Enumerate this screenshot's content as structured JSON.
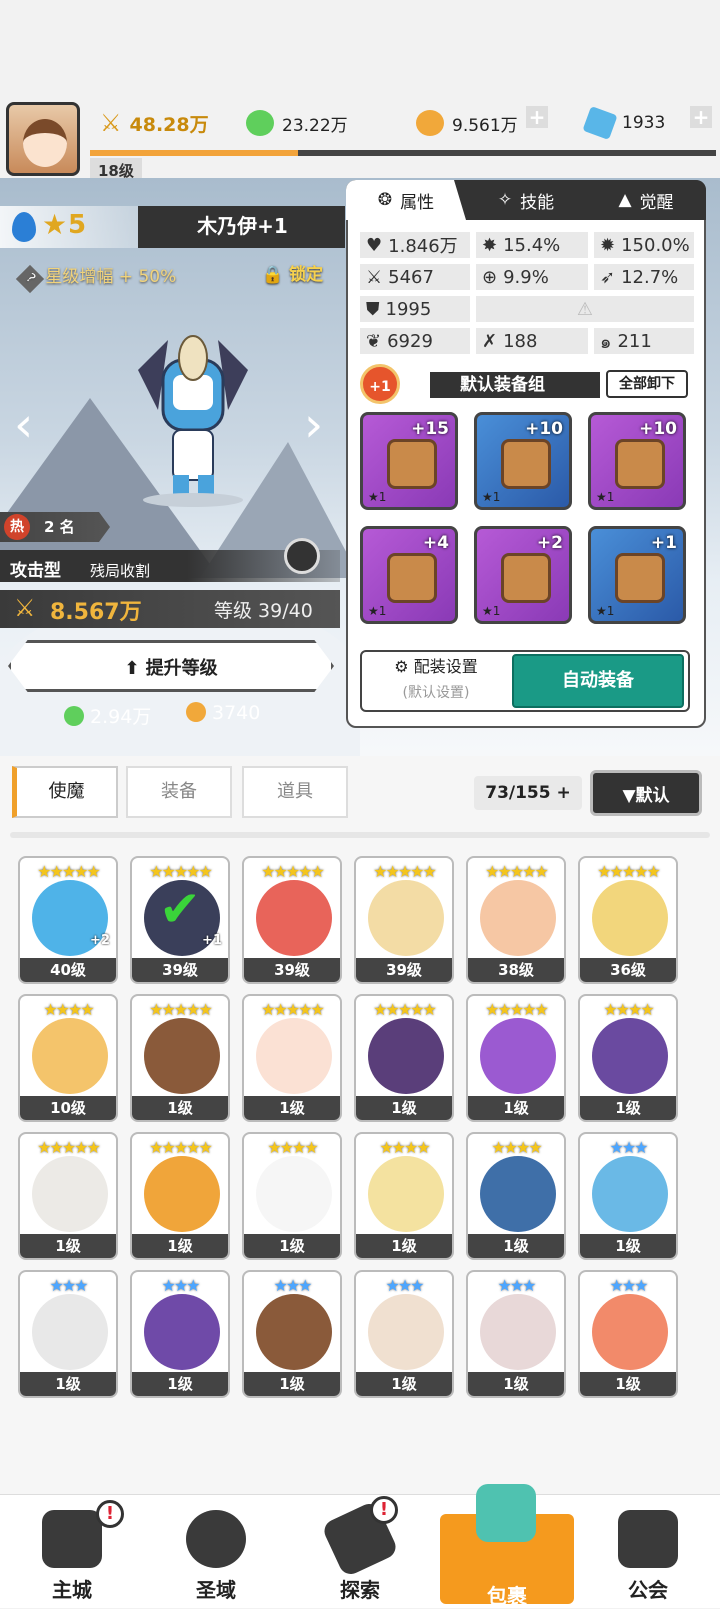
{
  "topbar": {
    "level": "18级",
    "power": "48.28万",
    "green": "23.22万",
    "gold": "9.561万",
    "gem": "1933"
  },
  "hero": {
    "stars": "5",
    "name": "木乃伊+1",
    "bonus": "星级增幅 + 50%",
    "lock": "锁定",
    "hot_tag": "热",
    "rank": "2 名",
    "type": "攻击型",
    "role": "残局收割",
    "power": "8.567万",
    "level": "等级 39/40",
    "upgrade": "提升等级",
    "cost_green": "2.94万",
    "cost_gold": "3740"
  },
  "panel": {
    "tabs": [
      "属性",
      "技能",
      "觉醒"
    ],
    "stats": {
      "hp": "1.846万",
      "crit": "15.4%",
      "critdmg": "150.0%",
      "atk": "5467",
      "acc": "9.9%",
      "speed": "12.7%",
      "def": "1995",
      "v1": "6929",
      "v2": "188",
      "v3": "211"
    },
    "equip_title": "默认装备组",
    "plus1": "+1",
    "unequip": "全部卸下",
    "equips": [
      {
        "lv": "+15",
        "st": "★1",
        "color": "purple"
      },
      {
        "lv": "+10",
        "st": "★1",
        "color": "blue"
      },
      {
        "lv": "+10",
        "st": "★1",
        "color": "purple"
      },
      {
        "lv": "+4",
        "st": "★1",
        "color": "purple"
      },
      {
        "lv": "+2",
        "st": "★1",
        "color": "purple"
      },
      {
        "lv": "+1",
        "st": "★1",
        "color": "blue"
      }
    ],
    "setting": "配装设置",
    "setting_sub": "(默认设置)",
    "auto": "自动装备"
  },
  "inventory": {
    "tabs": [
      "使魔",
      "装备",
      "道具"
    ],
    "count": "73/155",
    "count_plus": "+",
    "sort": "▼默认",
    "cards": [
      {
        "lv": "40级",
        "stars": "★★★★★",
        "plus": "+2"
      },
      {
        "lv": "39级",
        "stars": "★★★★★",
        "plus": "+1"
      },
      {
        "lv": "39级",
        "stars": "★★★★★",
        "plus": ""
      },
      {
        "lv": "39级",
        "stars": "★★★★★",
        "plus": ""
      },
      {
        "lv": "38级",
        "stars": "★★★★★",
        "plus": ""
      },
      {
        "lv": "36级",
        "stars": "★★★★★",
        "plus": ""
      },
      {
        "lv": "10级",
        "stars": "★★★★",
        "plus": ""
      },
      {
        "lv": "1级",
        "stars": "★★★★★",
        "plus": ""
      },
      {
        "lv": "1级",
        "stars": "★★★★★",
        "plus": ""
      },
      {
        "lv": "1级",
        "stars": "★★★★★",
        "plus": ""
      },
      {
        "lv": "1级",
        "stars": "★★★★★",
        "plus": ""
      },
      {
        "lv": "1级",
        "stars": "★★★★",
        "plus": ""
      },
      {
        "lv": "1级",
        "stars": "★★★★★",
        "plus": ""
      },
      {
        "lv": "1级",
        "stars": "★★★★★",
        "plus": ""
      },
      {
        "lv": "1级",
        "stars": "★★★★",
        "plus": ""
      },
      {
        "lv": "1级",
        "stars": "★★★★",
        "plus": ""
      },
      {
        "lv": "1级",
        "stars": "★★★★",
        "plus": ""
      },
      {
        "lv": "1级",
        "stars": "★★★",
        "plus": ""
      },
      {
        "lv": "1级",
        "stars": "★★★",
        "plus": ""
      },
      {
        "lv": "1级",
        "stars": "★★★",
        "plus": ""
      },
      {
        "lv": "1级",
        "stars": "★★★",
        "plus": ""
      },
      {
        "lv": "1级",
        "stars": "★★★",
        "plus": ""
      },
      {
        "lv": "1级",
        "stars": "★★★",
        "plus": ""
      },
      {
        "lv": "1级",
        "stars": "★★★",
        "plus": ""
      }
    ]
  },
  "nav": [
    "主城",
    "圣域",
    "探索",
    "包裹",
    "公会"
  ]
}
